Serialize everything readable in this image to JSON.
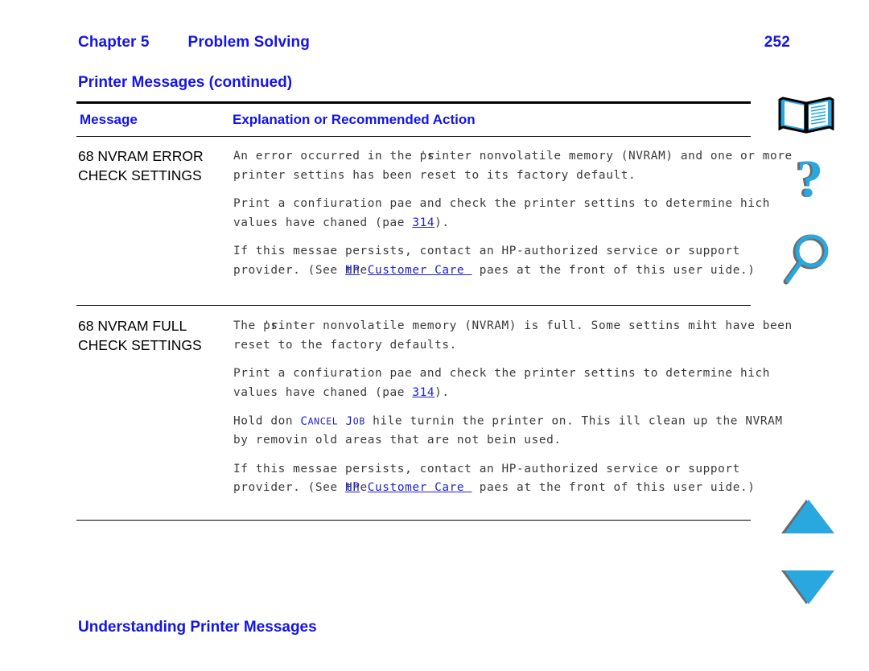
{
  "header": {
    "chapter_label": "Chapter 5",
    "chapter_title": "Problem Solving",
    "page_number": "252",
    "table_title": "Printer Messages (continued)"
  },
  "table": {
    "columns": {
      "message": "Message",
      "action": "Explanation or Recommended Action"
    },
    "rows": [
      {
        "message_line1": "68 NVRAM ERROR",
        "message_line2": "CHECK SETTINGS",
        "paragraphs": [
          {
            "id": "p1-1",
            "segments": [
              {
                "type": "text",
                "text": "An error occurred in the "
              },
              {
                "type": "overlap",
                "under": "printer",
                "over": "'s"
              },
              {
                "type": "text",
                "text": " nonvolatile memory (NVRAM) and one or more printer settins has been reset to its factory default."
              }
            ]
          },
          {
            "id": "p1-2",
            "segments": [
              {
                "type": "text",
                "text": "Print a confiuration pae and check the printer settins to determine hich values have chaned (pae "
              },
              {
                "type": "link",
                "text": "314"
              },
              {
                "type": "text",
                "text": ")."
              }
            ]
          },
          {
            "id": "p1-3",
            "segments": [
              {
                "type": "text",
                "text": "If this messae persists, contact an HP-authorized service or support provider. (See "
              },
              {
                "type": "overlap-link",
                "under": "the",
                "over": "HP"
              },
              {
                "type": "link",
                "text": "Customer Care "
              },
              {
                "type": "text",
                "text": " paes at the front of this user uide.)"
              }
            ]
          }
        ]
      },
      {
        "message_line1": "68 NVRAM FULL",
        "message_line2": "CHECK SETTINGS",
        "paragraphs": [
          {
            "id": "p2-1",
            "segments": [
              {
                "type": "text",
                "text": "The "
              },
              {
                "type": "overlap",
                "under": "printer",
                "over": "'s"
              },
              {
                "type": "text",
                "text": " nonvolatile memory (NVRAM) is full. Some settins miht have been reset to the factory defaults."
              }
            ]
          },
          {
            "id": "p2-2",
            "segments": [
              {
                "type": "text",
                "text": "Print a confiuration pae and check the printer settins to determine hich values have chaned (pae "
              },
              {
                "type": "link",
                "text": "314"
              },
              {
                "type": "text",
                "text": ")."
              }
            ]
          },
          {
            "id": "p2-3",
            "segments": [
              {
                "type": "text",
                "text": "Hold don "
              },
              {
                "type": "key",
                "initial": "C",
                "rest": "ANCEL"
              },
              {
                "type": "text",
                "text": " "
              },
              {
                "type": "key",
                "initial": "J",
                "rest": "OB"
              },
              {
                "type": "text",
                "text": " hile turnin the printer on. This ill clean up the NVRAM by removin old areas that are not bein used."
              }
            ]
          },
          {
            "id": "p2-4",
            "segments": [
              {
                "type": "text",
                "text": "If this messae persists, contact an HP-authorized service or support provider. (See "
              },
              {
                "type": "overlap-link",
                "under": "the",
                "over": "HP"
              },
              {
                "type": "link",
                "text": "Customer Care "
              },
              {
                "type": "text",
                "text": " paes at the front of this user uide.)"
              }
            ]
          }
        ]
      }
    ]
  },
  "footer": {
    "text": "Understanding Printer Messages"
  },
  "nav_icons": [
    {
      "name": "book-icon",
      "label": "Contents"
    },
    {
      "name": "question-mark-icon",
      "label": "Help"
    },
    {
      "name": "magnifier-icon",
      "label": "Search"
    },
    {
      "name": "triangle-up-icon",
      "label": "Previous page"
    },
    {
      "name": "triangle-down-icon",
      "label": "Next page"
    }
  ],
  "colors": {
    "heading_blue": "#1414e6",
    "link_blue": "#2020d0",
    "icon_cyan": "#29a8e0",
    "icon_shadow": "#6b6b6b",
    "body_gray": "#3a3a3a"
  }
}
